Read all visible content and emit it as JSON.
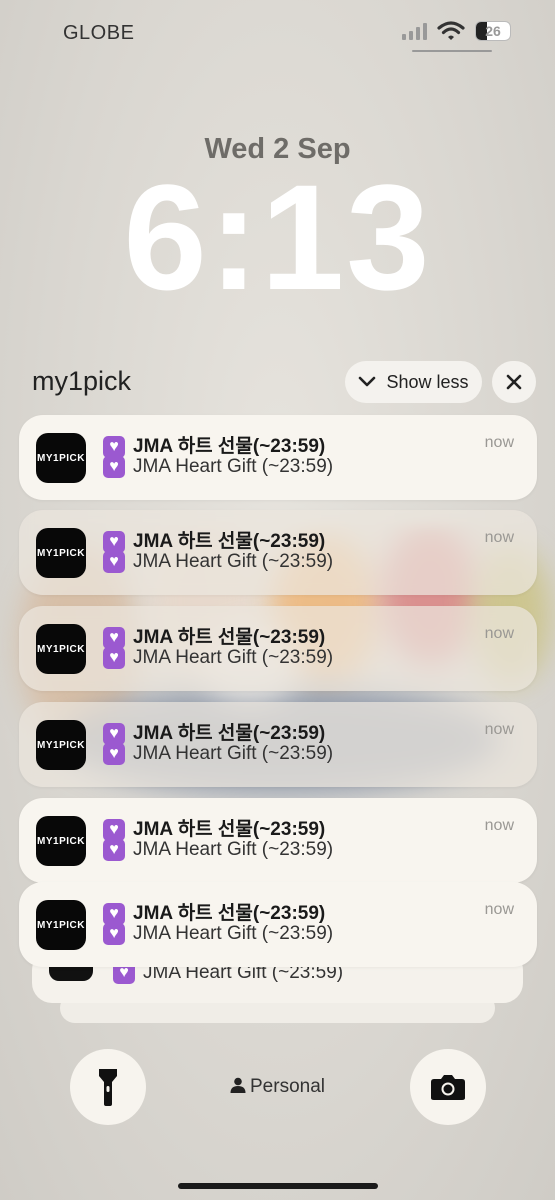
{
  "status_bar": {
    "carrier": "GLOBE",
    "battery": "26",
    "icons": [
      "signal-icon",
      "wifi-icon",
      "battery-icon"
    ]
  },
  "lock_screen": {
    "date": "Wed 2 Sep",
    "time": "6:13"
  },
  "group": {
    "app_name": "my1pick",
    "show_less_label": "Show less"
  },
  "app_icon_label": "MY1PICK",
  "notifications": [
    {
      "title": "JMA 하트 선물(~23:59)",
      "body": "JMA Heart Gift (~23:59)",
      "time": "now"
    },
    {
      "title": "JMA 하트 선물(~23:59)",
      "body": "JMA Heart Gift (~23:59)",
      "time": "now"
    },
    {
      "title": "JMA 하트 선물(~23:59)",
      "body": "JMA Heart Gift (~23:59)",
      "time": "now"
    },
    {
      "title": "JMA 하트 선물(~23:59)",
      "body": "JMA Heart Gift (~23:59)",
      "time": "now"
    },
    {
      "title": "JMA 하트 선물(~23:59)",
      "body": "JMA Heart Gift (~23:59)",
      "time": "now"
    },
    {
      "title": "JMA 하트 선물(~23:59)",
      "body": "JMA Heart Gift (~23:59)",
      "time": "now"
    }
  ],
  "stacked": {
    "body": "JMA Heart Gift (~23:59)"
  },
  "bottom": {
    "focus_label": "Personal",
    "left_icon": "flashlight-icon",
    "right_icon": "camera-icon"
  },
  "colors": {
    "accent_heart": "#9b59d0",
    "card": "#f8f5ef"
  }
}
